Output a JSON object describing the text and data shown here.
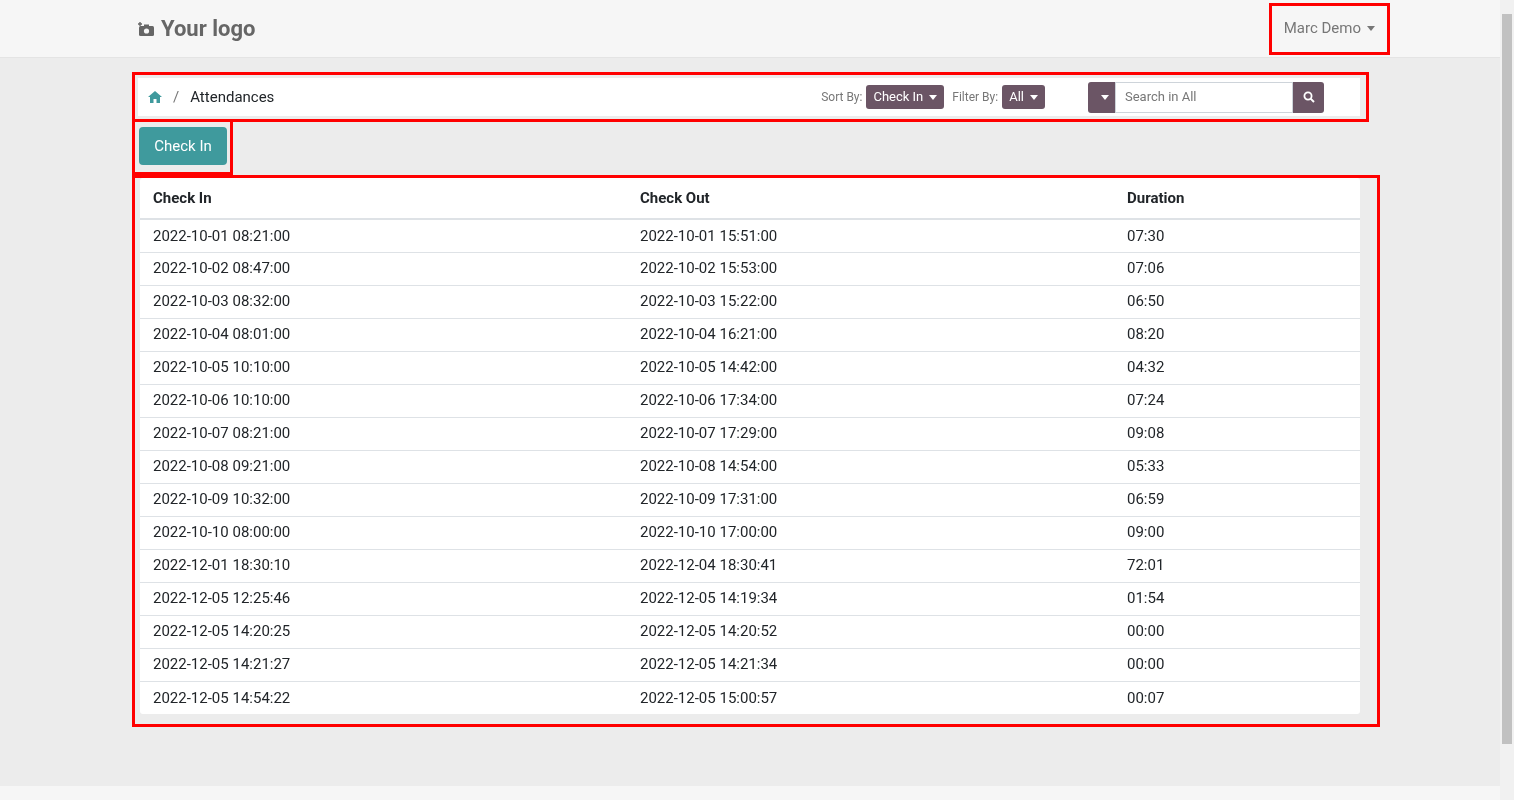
{
  "header": {
    "logo": "Your logo",
    "user": "Marc Demo"
  },
  "breadcrumb": {
    "current": "Attendances",
    "separator": "/"
  },
  "sort": {
    "label": "Sort By:",
    "value": "Check In"
  },
  "filter": {
    "label": "Filter By:",
    "value": "All"
  },
  "search": {
    "placeholder": "Search in All"
  },
  "action_button": "Check In",
  "table": {
    "columns": [
      "Check In",
      "Check Out",
      "Duration"
    ],
    "rows": [
      [
        "2022-10-01 08:21:00",
        "2022-10-01 15:51:00",
        "07:30"
      ],
      [
        "2022-10-02 08:47:00",
        "2022-10-02 15:53:00",
        "07:06"
      ],
      [
        "2022-10-03 08:32:00",
        "2022-10-03 15:22:00",
        "06:50"
      ],
      [
        "2022-10-04 08:01:00",
        "2022-10-04 16:21:00",
        "08:20"
      ],
      [
        "2022-10-05 10:10:00",
        "2022-10-05 14:42:00",
        "04:32"
      ],
      [
        "2022-10-06 10:10:00",
        "2022-10-06 17:34:00",
        "07:24"
      ],
      [
        "2022-10-07 08:21:00",
        "2022-10-07 17:29:00",
        "09:08"
      ],
      [
        "2022-10-08 09:21:00",
        "2022-10-08 14:54:00",
        "05:33"
      ],
      [
        "2022-10-09 10:32:00",
        "2022-10-09 17:31:00",
        "06:59"
      ],
      [
        "2022-10-10 08:00:00",
        "2022-10-10 17:00:00",
        "09:00"
      ],
      [
        "2022-12-01 18:30:10",
        "2022-12-04 18:30:41",
        "72:01"
      ],
      [
        "2022-12-05 12:25:46",
        "2022-12-05 14:19:34",
        "01:54"
      ],
      [
        "2022-12-05 14:20:25",
        "2022-12-05 14:20:52",
        "00:00"
      ],
      [
        "2022-12-05 14:21:27",
        "2022-12-05 14:21:34",
        "00:00"
      ],
      [
        "2022-12-05 14:54:22",
        "2022-12-05 15:00:57",
        "00:07"
      ]
    ]
  }
}
